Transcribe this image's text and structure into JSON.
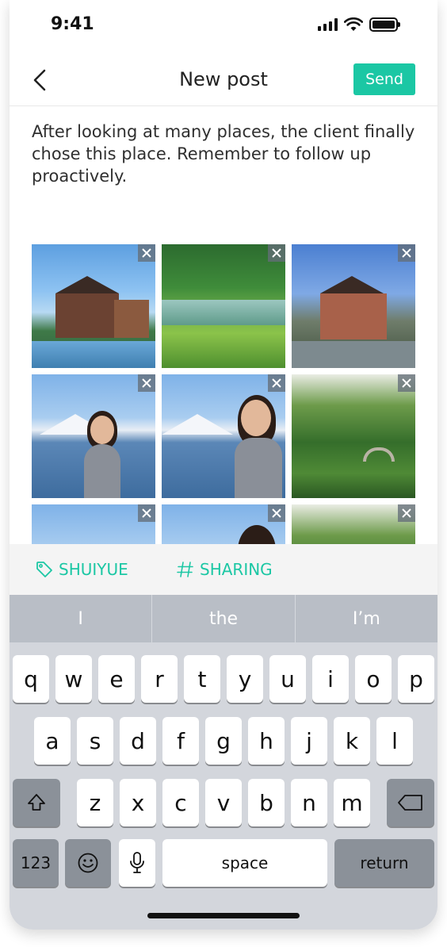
{
  "status_bar": {
    "time": "9:41",
    "icons": [
      "cellular-signal-icon",
      "wifi-icon",
      "battery-icon"
    ]
  },
  "nav": {
    "title": "New post",
    "send_label": "Send",
    "back_icon": "chevron-left-icon"
  },
  "post": {
    "text": "After looking at many places, the client finally chose this place. Remember to follow up proactively."
  },
  "images": [
    {
      "name": "villa-photo"
    },
    {
      "name": "pond-photo"
    },
    {
      "name": "manor-photo"
    },
    {
      "name": "selfie-photo"
    },
    {
      "name": "selfie-photo"
    },
    {
      "name": "garden-photo"
    },
    {
      "name": "selfie-photo"
    },
    {
      "name": "selfie-photo"
    },
    {
      "name": "garden-photo"
    }
  ],
  "tags": {
    "location": {
      "label": "SHUIYUE",
      "icon": "tag-icon"
    },
    "topic": {
      "label": "SHARING",
      "icon": "hashtag-icon"
    }
  },
  "keyboard": {
    "suggestions": [
      "I",
      "the",
      "I’m"
    ],
    "rows": [
      [
        "q",
        "w",
        "e",
        "r",
        "t",
        "y",
        "u",
        "i",
        "o",
        "p"
      ],
      [
        "a",
        "s",
        "d",
        "f",
        "g",
        "h",
        "j",
        "k",
        "l"
      ],
      [
        "z",
        "x",
        "c",
        "v",
        "b",
        "n",
        "m"
      ]
    ],
    "numbers_label": "123",
    "space_label": "space",
    "return_label": "return"
  },
  "colors": {
    "accent": "#1bc7a4",
    "keyboard_bg": "#d3d6dc"
  }
}
